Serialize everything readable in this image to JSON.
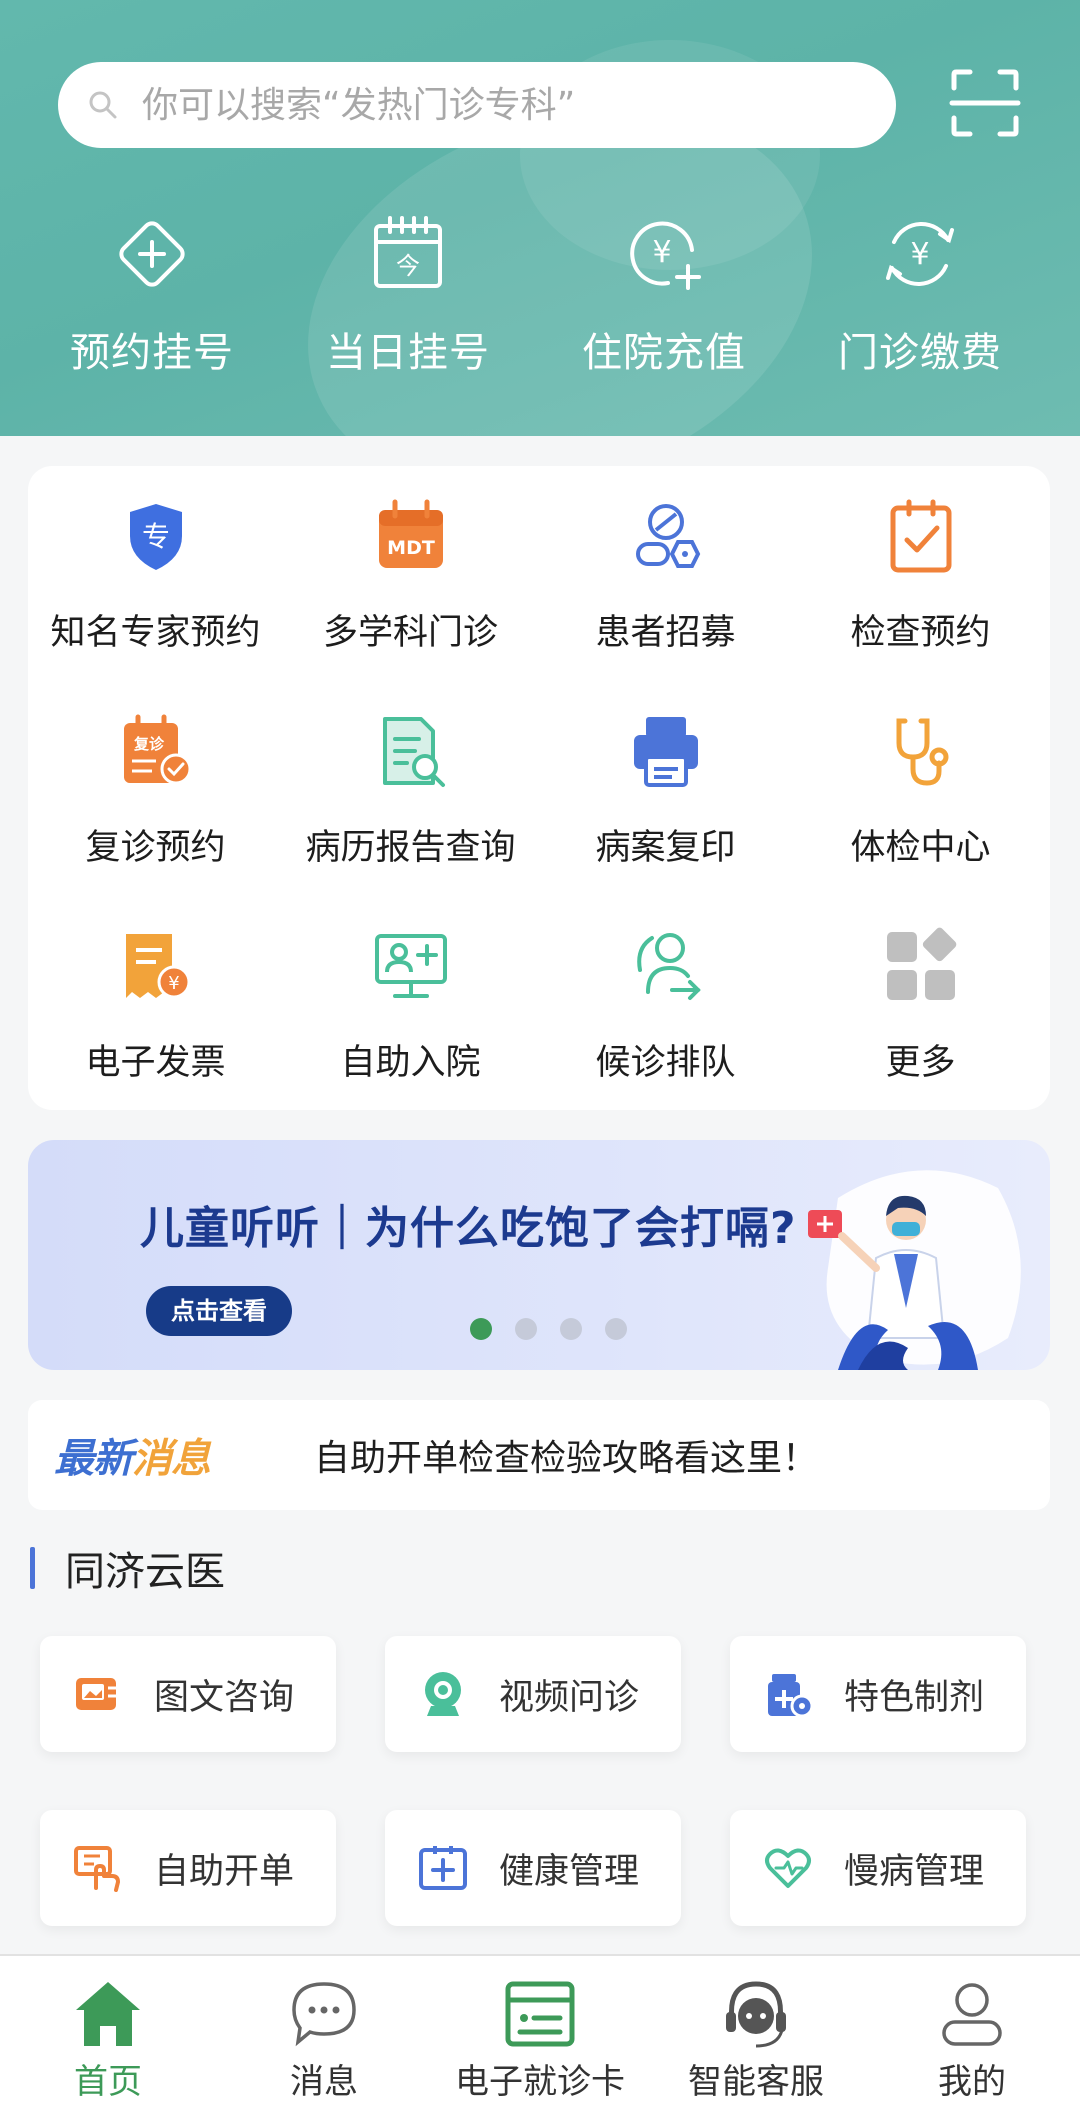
{
  "search": {
    "placeholder": "你可以搜索“发热门诊专科”"
  },
  "quick_actions": [
    {
      "label": "预约挂号",
      "icon": "plus-diamond-icon"
    },
    {
      "label": "当日挂号",
      "icon": "calendar-today-icon"
    },
    {
      "label": "住院充值",
      "icon": "yuan-plus-icon"
    },
    {
      "label": "门诊缴费",
      "icon": "yuan-refresh-icon"
    }
  ],
  "services": [
    {
      "label": "知名专家预约",
      "icon": "expert-shield-icon"
    },
    {
      "label": "多学科门诊",
      "icon": "mdt-calendar-icon"
    },
    {
      "label": "患者招募",
      "icon": "pill-recruit-icon"
    },
    {
      "label": "检查预约",
      "icon": "check-clipboard-icon"
    },
    {
      "label": "复诊预约",
      "icon": "revisit-calendar-icon"
    },
    {
      "label": "病历报告查询",
      "icon": "report-search-icon"
    },
    {
      "label": "病案复印",
      "icon": "printer-icon"
    },
    {
      "label": "体检中心",
      "icon": "stethoscope-icon"
    },
    {
      "label": "电子发票",
      "icon": "invoice-icon"
    },
    {
      "label": "自助入院",
      "icon": "monitor-admission-icon"
    },
    {
      "label": "候诊排队",
      "icon": "queue-person-icon"
    },
    {
      "label": "更多",
      "icon": "more-grid-icon"
    }
  ],
  "banner": {
    "title": "儿童听听｜为什么吃饱了会打嗝?",
    "button": "点击查看",
    "slides": 4,
    "active_slide": 1
  },
  "news": {
    "tag_part1": "最新",
    "tag_part2": "消息",
    "text": "自助开单检查检验攻略看这里！"
  },
  "section": {
    "title": "同济云医",
    "items": [
      {
        "label": "图文咨询",
        "icon": "image-chat-icon"
      },
      {
        "label": "视频问诊",
        "icon": "video-camera-icon"
      },
      {
        "label": "特色制剂",
        "icon": "medicine-bottle-icon"
      },
      {
        "label": "自助开单",
        "icon": "self-order-icon"
      },
      {
        "label": "健康管理",
        "icon": "health-box-icon"
      },
      {
        "label": "慢病管理",
        "icon": "heart-care-icon"
      }
    ]
  },
  "tabbar": [
    {
      "label": "首页",
      "icon": "home-icon",
      "active": true
    },
    {
      "label": "消息",
      "icon": "message-icon",
      "active": false
    },
    {
      "label": "电子就诊卡",
      "icon": "card-icon",
      "active": false
    },
    {
      "label": "智能客服",
      "icon": "headset-icon",
      "active": false
    },
    {
      "label": "我的",
      "icon": "user-icon",
      "active": false
    }
  ],
  "colors": {
    "header": "#5fb4a9",
    "accent_green": "#3d9a58",
    "blue": "#4c74d8",
    "orange": "#f08a3c"
  }
}
